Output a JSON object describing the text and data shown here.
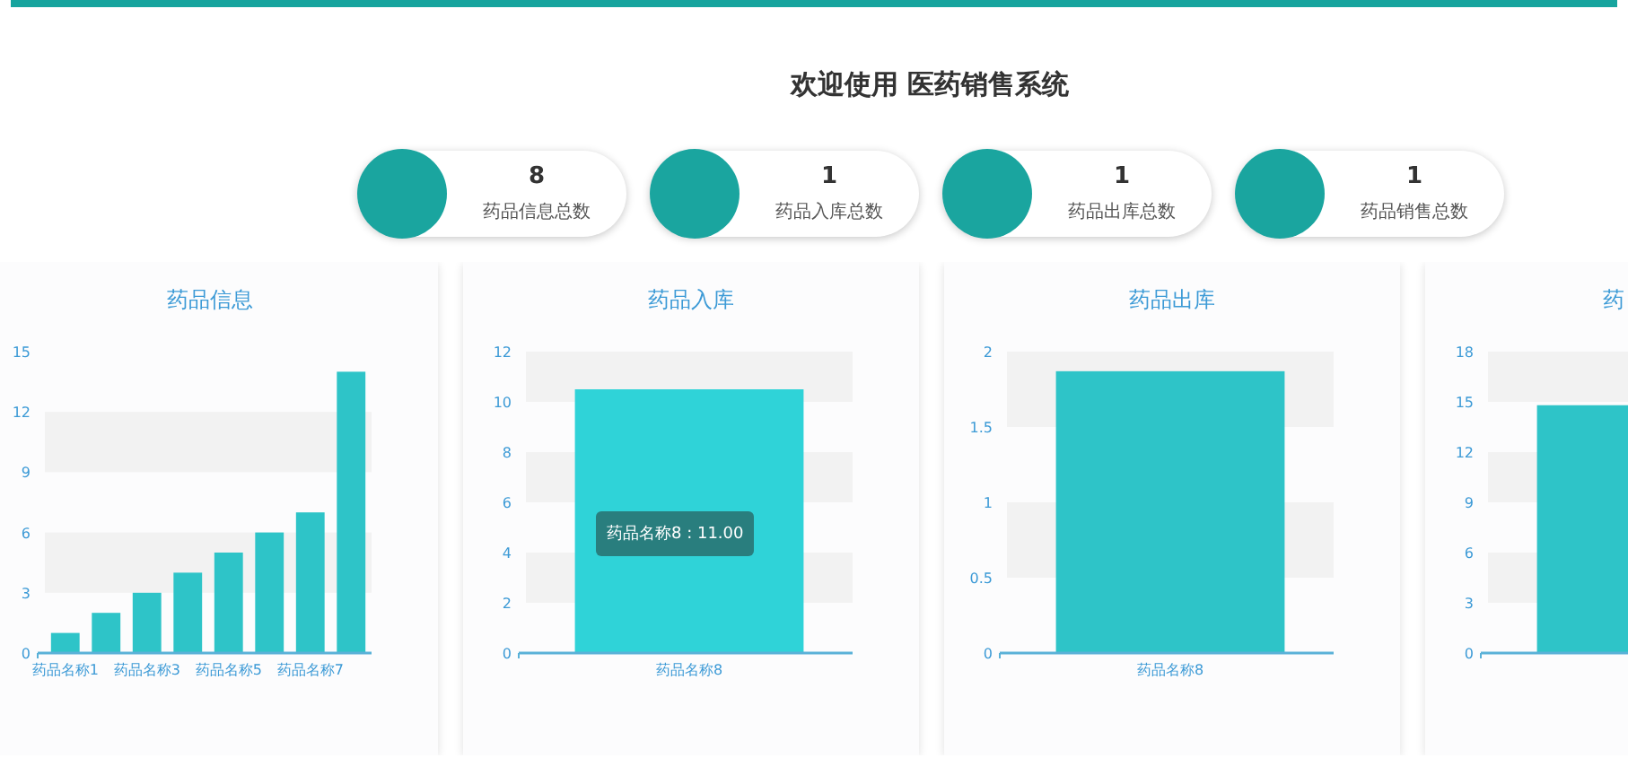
{
  "title": "欢迎使用 医药销售系统",
  "stats": [
    {
      "value": "8",
      "label": "药品信息总数"
    },
    {
      "value": "1",
      "label": "药品入库总数"
    },
    {
      "value": "1",
      "label": "药品出库总数"
    },
    {
      "value": "1",
      "label": "药品销售总数"
    }
  ],
  "charts": [
    {
      "chart_data": {
        "type": "bar",
        "title": "药品信息",
        "categories": [
          "药品名称1",
          null,
          "药品名称3",
          null,
          "药品名称5",
          null,
          "药品名称7",
          null
        ],
        "values": [
          1,
          2,
          3,
          4,
          5,
          6,
          7,
          14
        ],
        "ylim": [
          0,
          15
        ],
        "yticks": [
          0,
          3,
          6,
          9,
          12,
          15
        ]
      }
    },
    {
      "tooltip": "药品名称8 : 11.00",
      "chart_data": {
        "type": "bar",
        "title": "药品入库",
        "categories": [
          "药品名称8"
        ],
        "values": [
          10.5
        ],
        "ylim": [
          0,
          12
        ],
        "yticks": [
          0,
          2,
          4,
          6,
          8,
          10,
          12
        ]
      }
    },
    {
      "chart_data": {
        "type": "bar",
        "title": "药品出库",
        "categories": [
          "药品名称8"
        ],
        "values": [
          1.87
        ],
        "ylim": [
          0,
          2
        ],
        "yticks": [
          0,
          0.5,
          1,
          1.5,
          2
        ]
      }
    },
    {
      "chart_data": {
        "type": "bar",
        "title": "药",
        "categories": [
          null
        ],
        "values": [
          14.8
        ],
        "ylim": [
          0,
          18
        ],
        "yticks": [
          0,
          3,
          6,
          9,
          12,
          15,
          18
        ]
      }
    }
  ]
}
